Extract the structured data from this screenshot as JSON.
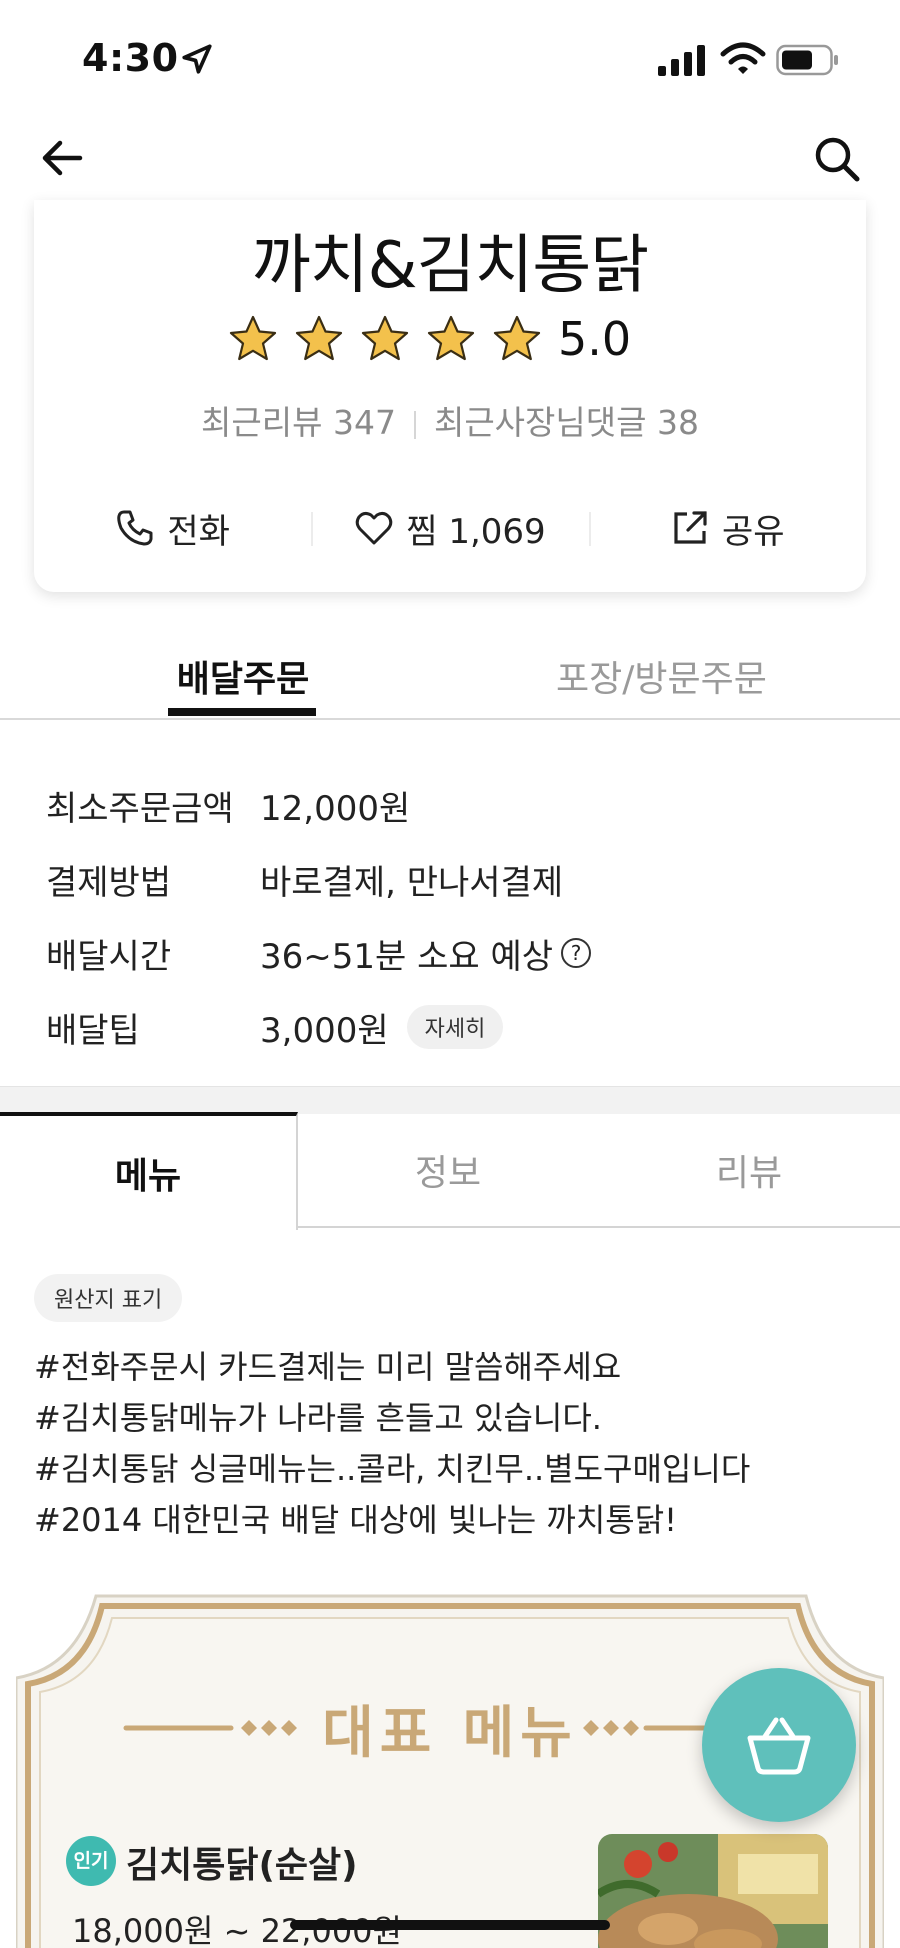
{
  "status_bar": {
    "time": "4:30"
  },
  "store": {
    "name": "까치&김치통닭",
    "rating": "5.0",
    "rating_stars": 5,
    "recent_reviews": "최근리뷰 347",
    "owner_replies": "최근사장님댓글 38",
    "call_label": "전화",
    "like_label": "찜 1,069",
    "share_label": "공유"
  },
  "order_tabs": {
    "delivery": "배달주문",
    "pickup": "포장/방문주문"
  },
  "delivery_info": {
    "min_order_label": "최소주문금액",
    "min_order_value": "12,000원",
    "payment_label": "결제방법",
    "payment_value": "바로결제, 만나서결제",
    "time_label": "배달시간",
    "time_value": "36~51분 소요 예상",
    "tip_label": "배달팁",
    "tip_value": "3,000원",
    "tip_detail": "자세히"
  },
  "section_tabs": {
    "menu": "메뉴",
    "info": "정보",
    "reviews": "리뷰"
  },
  "notices": {
    "origin_chip": "원산지 표기",
    "lines": [
      "#전화주문시 카드결제는 미리 말씀해주세요",
      "#김치통닭메뉴가 나라를 흔들고 있습니다.",
      "#김치통닭 싱글메뉴는..콜라, 치킨무..별도구매입니다",
      "#2014 대한민국 배달 대상에 빛나는 까치통닭!"
    ]
  },
  "featured": {
    "title": "대표 메뉴",
    "badge": "인기",
    "item_name": "김치통닭(순살)",
    "item_price": "18,000원 ~ 22,000원"
  },
  "colors": {
    "accent_teal": "#5fc0bb",
    "gold": "#c9a877",
    "star": "#f3c14c"
  }
}
